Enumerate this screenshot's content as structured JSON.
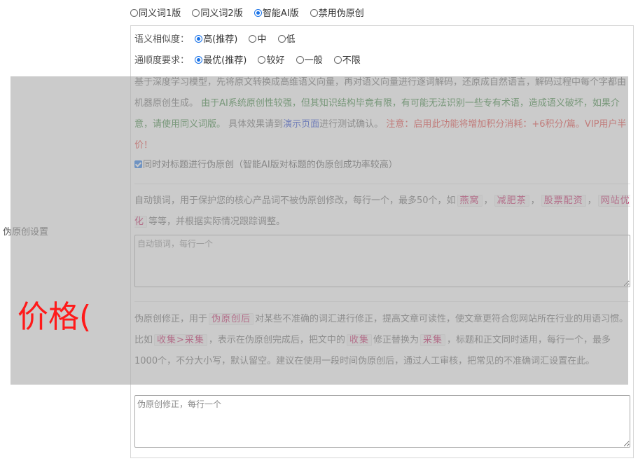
{
  "version_options": [
    {
      "label": "同义词1版",
      "selected": false
    },
    {
      "label": "同义词2版",
      "selected": false
    },
    {
      "label": "智能AI版",
      "selected": true
    },
    {
      "label": "禁用伪原创",
      "selected": false
    }
  ],
  "similarity": {
    "label": "语义相似度：",
    "options": [
      {
        "label": "高(推荐)",
        "selected": true
      },
      {
        "label": "中",
        "selected": false
      },
      {
        "label": "低",
        "selected": false
      }
    ]
  },
  "fluency": {
    "label": "通顺度要求：",
    "options": [
      {
        "label": "最优(推荐)",
        "selected": true
      },
      {
        "label": "较好",
        "selected": false
      },
      {
        "label": "一般",
        "selected": false
      },
      {
        "label": "不限",
        "selected": false
      }
    ]
  },
  "ai_desc": {
    "part1": "基于深度学习模型，先将原文转换成高维语义向量，再对语义向量进行逐词解码，还原成自然语言，解码过程中每个字都由机器原创生成。 ",
    "part2": "由于AI系统原创性较强，但其知识结构毕竟有限，有可能无法识别一些专有术语，造成语义破坏，如果介意，请使用同义词版。",
    "part3": " 具体效果请到",
    "link": "演示页面",
    "part4": "进行测试确认。 ",
    "part5": "注意：启用此功能将增加积分消耗：+6积分/篇。VIP用户半价！"
  },
  "title_checkbox": {
    "label": "同时对标题进行伪原创（智能AI版对标题的伪原创成功率较高）",
    "checked": true
  },
  "lock_words": {
    "desc_before": "自动锁词，用于保护您的核心产品词不被伪原创修改，每行一个，最多50个，如",
    "tags": [
      "燕窝",
      "减肥茶",
      "股票配资",
      "网站优化"
    ],
    "sep": "，",
    "desc_after": "等等，并根据实际情况跟踪调整。",
    "placeholder": "自动锁词，每行一个"
  },
  "correction": {
    "t1": "伪原创修正，用于",
    "tag1": "伪原创后",
    "t2": "对某些不准确的词汇进行修正，提高文章可读性，使文章更符合您网站所在行业的用语习惯。比如",
    "tag2": "收集>采集",
    "t3": "，表示在伪原创完成后，把文中的",
    "tag3": "收集",
    "t4": "修正替换为",
    "tag4": "采集",
    "t5": "，标题和正文同时适用，每行一个，最多1000个，不分大小写，默认留空。建议在使用一段时间伪原创后，通过人工审核，把常见的不准确词汇设置在此。",
    "placeholder": "伪原创修正，每行一个"
  },
  "side_label": "伪原创设置",
  "overlay_text": "价格("
}
